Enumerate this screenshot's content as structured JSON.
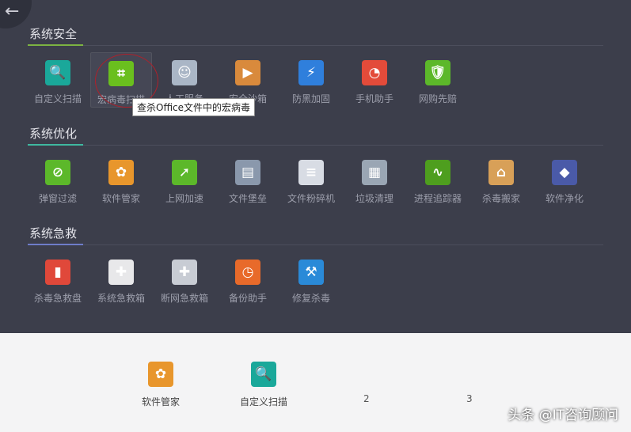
{
  "back_label": "←",
  "sections": [
    {
      "title": "系统安全",
      "accent": "#7cb342",
      "items": [
        {
          "label": "自定义扫描",
          "icon": "magnifier-icon",
          "glyph": "🔍",
          "color": "#1aa89a"
        },
        {
          "label": "宏病毒扫描",
          "icon": "macro-scan-icon",
          "glyph": "⌗",
          "color": "#6abf1e"
        },
        {
          "label": "人工服务",
          "icon": "doctor-icon",
          "glyph": "☺",
          "color": "#aab6c6"
        },
        {
          "label": "安全沙箱",
          "icon": "sandbox-icon",
          "glyph": "▶",
          "color": "#d98a3c"
        },
        {
          "label": "防黑加固",
          "icon": "lightning-icon",
          "glyph": "⚡",
          "color": "#2f7fdc"
        },
        {
          "label": "手机助手",
          "icon": "phone-assistant-icon",
          "glyph": "◔",
          "color": "#e34b3a"
        },
        {
          "label": "网购先赔",
          "icon": "shopping-shield-icon",
          "glyph": "🛡",
          "color": "#5cb82a"
        }
      ]
    },
    {
      "title": "系统优化",
      "accent": "#3fb8a0",
      "items": [
        {
          "label": "弹窗过滤",
          "icon": "popup-filter-icon",
          "glyph": "⊘",
          "color": "#5cb82a"
        },
        {
          "label": "软件管家",
          "icon": "software-manager-icon",
          "glyph": "✿",
          "color": "#e8962c"
        },
        {
          "label": "上网加速",
          "icon": "rocket-icon",
          "glyph": "➚",
          "color": "#5cb82a"
        },
        {
          "label": "文件堡垒",
          "icon": "file-fortress-icon",
          "glyph": "▤",
          "color": "#8a98ac"
        },
        {
          "label": "文件粉碎机",
          "icon": "shredder-icon",
          "glyph": "≡",
          "color": "#d8dce4"
        },
        {
          "label": "垃圾清理",
          "icon": "cleanup-icon",
          "glyph": "▦",
          "color": "#9aa6b4"
        },
        {
          "label": "进程追踪器",
          "icon": "process-tracker-icon",
          "glyph": "∿",
          "color": "#4e9e1e"
        },
        {
          "label": "杀毒搬家",
          "icon": "house-icon",
          "glyph": "⌂",
          "color": "#d8a058"
        },
        {
          "label": "软件净化",
          "icon": "layers-icon",
          "glyph": "◆",
          "color": "#4a5aa8"
        }
      ]
    },
    {
      "title": "系统急救",
      "accent": "#6e7cc8",
      "items": [
        {
          "label": "杀毒急救盘",
          "icon": "usb-rescue-icon",
          "glyph": "▮",
          "color": "#e0483a"
        },
        {
          "label": "系统急救箱",
          "icon": "first-aid-kit-icon",
          "glyph": "✚",
          "color": "#e8e8ea"
        },
        {
          "label": "断网急救箱",
          "icon": "offline-aid-kit-icon",
          "glyph": "✚",
          "color": "#c8ccd4"
        },
        {
          "label": "备份助手",
          "icon": "backup-clock-icon",
          "glyph": "◷",
          "color": "#e86a2a"
        },
        {
          "label": "修复杀毒",
          "icon": "repair-shield-icon",
          "glyph": "⚒",
          "color": "#2a8ad8"
        }
      ]
    }
  ],
  "tooltip": "查杀Office文件中的宏病毒",
  "bottom": {
    "items": [
      {
        "label": "软件管家",
        "icon": "software-manager-icon",
        "glyph": "✿",
        "color": "#e8962c"
      },
      {
        "label": "自定义扫描",
        "icon": "magnifier-icon",
        "glyph": "🔍",
        "color": "#1aa89a"
      }
    ],
    "slots": [
      "2",
      "3"
    ]
  },
  "watermark": "头条 @IT咨询顾问"
}
